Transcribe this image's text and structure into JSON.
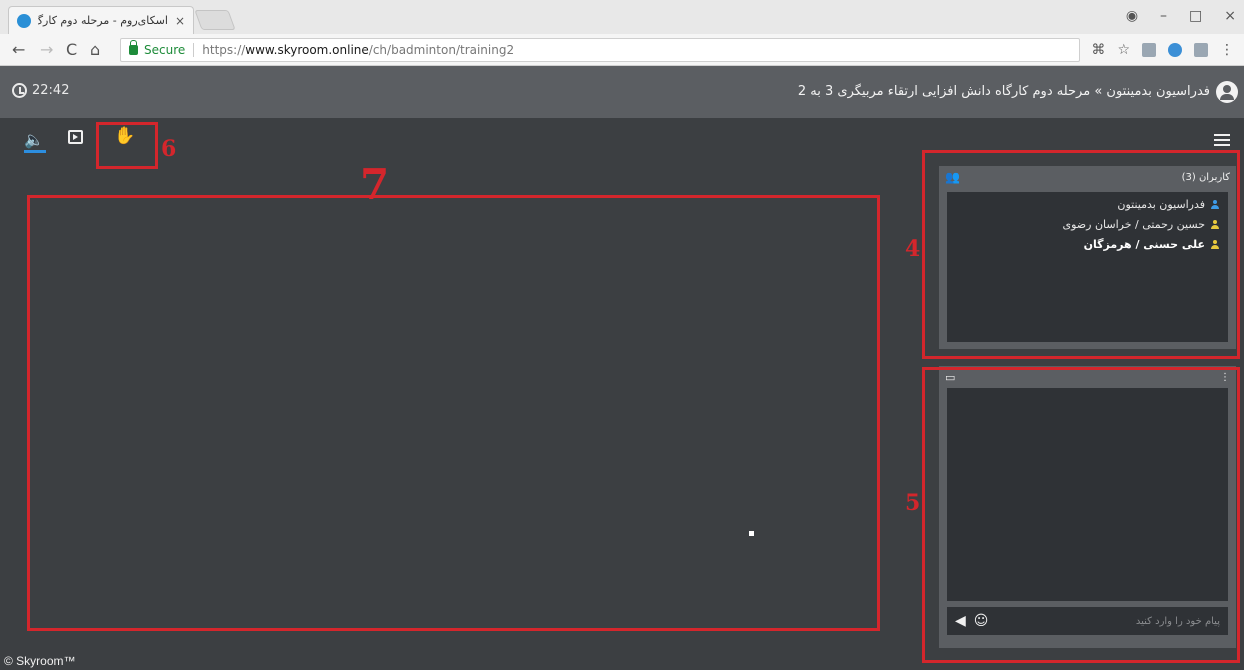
{
  "browser": {
    "tab_title": "اسکای‌روم - مرحله دوم کارگ",
    "tab_close": "×",
    "window_controls": [
      "–",
      "□",
      "×"
    ],
    "secure_label": "Secure",
    "url_scheme": "https://",
    "url_host": "www.skyroom.online",
    "url_path": "/ch/badminton/training2",
    "nav": {
      "back": "←",
      "forward": "→",
      "reload": "C",
      "home": "⌂"
    },
    "extension_icons": [
      "translate-icon",
      "star-icon",
      "extension-icon",
      "extension-icon",
      "extension-icon",
      "menu-icon"
    ]
  },
  "header": {
    "time": "22:42",
    "room_title": "فدراسیون بدمینتون » مرحله دوم کارگاه دانش افزایی ارتقاء مربیگری 3 به 2"
  },
  "controls": {
    "speaker_icon": "🔈",
    "hand_icon": "✋"
  },
  "users": {
    "title": "کاربران (3)",
    "list": [
      {
        "name": "فدراسیون بدمینتون",
        "color": "#3d9be9",
        "bold": false
      },
      {
        "name": "حسین رحمتی / خراسان رضوی",
        "color": "#e9c93d",
        "bold": false
      },
      {
        "name": "علی حسنی / هرمزگان",
        "color": "#e9c93d",
        "bold": true
      }
    ]
  },
  "chat": {
    "placeholder": "پیام خود را وارد کنید",
    "more_icon": "⋮",
    "emoji_icon": "☺",
    "send_icon": "◀"
  },
  "annotations": {
    "labels": [
      "4",
      "5",
      "6",
      "7"
    ],
    "color": "#d4262c"
  },
  "footer": "© Skyroom™"
}
